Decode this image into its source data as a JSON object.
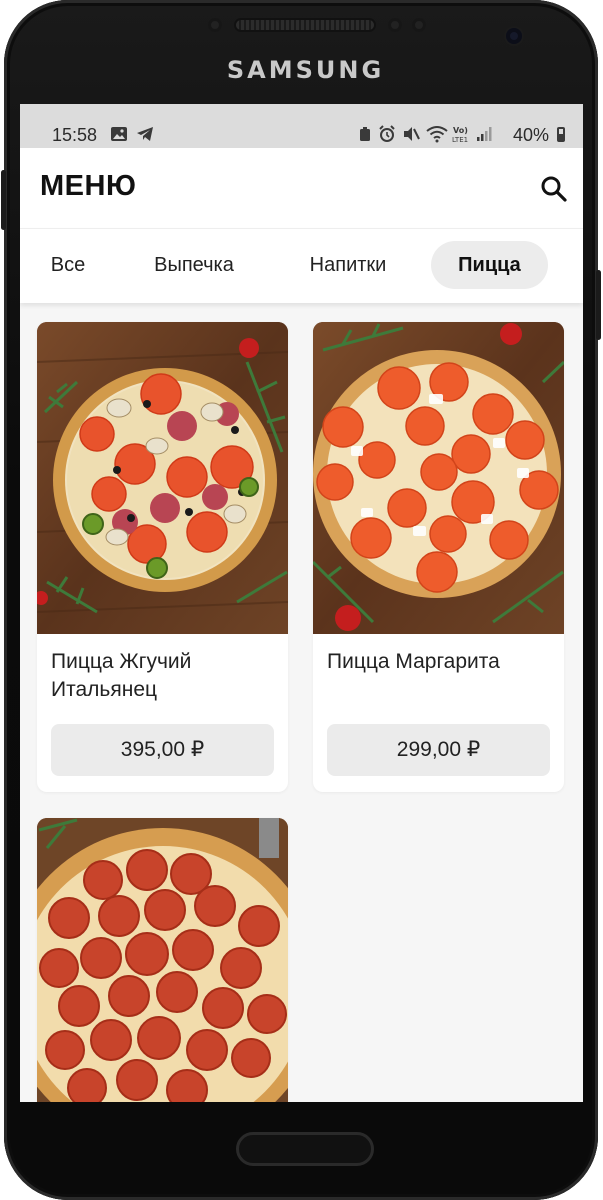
{
  "device": {
    "brand": "SAMSUNG"
  },
  "status_bar": {
    "time": "15:58",
    "battery": "40%",
    "icons": [
      "image-icon",
      "telegram-icon",
      "alarm-icon",
      "mute-icon",
      "wifi-icon",
      "volte-icon",
      "signal-icon",
      "battery-icon"
    ]
  },
  "header": {
    "title": "МЕНЮ",
    "search_icon": "search-icon"
  },
  "tabs": [
    {
      "label": "Все",
      "active": false
    },
    {
      "label": "Выпечка",
      "active": false
    },
    {
      "label": "Напитки",
      "active": false
    },
    {
      "label": "Пицца",
      "active": true
    }
  ],
  "products": [
    {
      "name": "Пицца Жгучий Итальянец",
      "price": "395,00 ₽",
      "image": "pizza-hot-italian-image"
    },
    {
      "name": "Пицца Маргарита",
      "price": "299,00 ₽",
      "image": "pizza-margherita-image"
    },
    {
      "name": "",
      "price": "",
      "image": "pizza-pepperoni-image"
    }
  ],
  "colors": {
    "active_tab_bg": "#ececec",
    "price_button_bg": "#ebebeb",
    "status_bar_bg": "#dcdcdc",
    "screen_bg": "#f6f6f6"
  }
}
